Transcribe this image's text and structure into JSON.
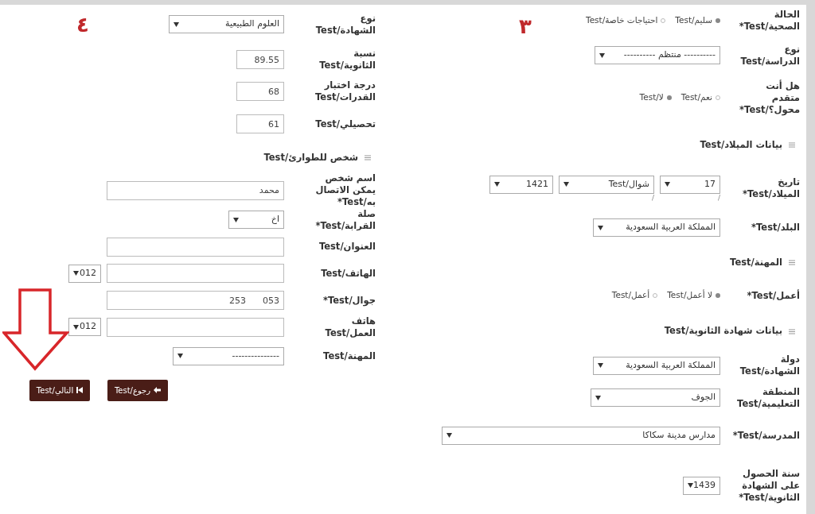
{
  "right_column": {
    "annotation": "٣",
    "rows": [
      {
        "kind": "radio",
        "label": "الحالة الصحية/Test*",
        "options": [
          {
            "label": "سليم/Test",
            "selected": true
          },
          {
            "label": "احتياجات خاصة/Test",
            "selected": false
          }
        ]
      },
      {
        "kind": "select",
        "label": "نوع الدراسة/Test",
        "value": "---------- منتظم ----------"
      },
      {
        "kind": "radio",
        "label": "هل أنت متقدم محول؟/Test*",
        "options": [
          {
            "label": "نعم/Test",
            "selected": false
          },
          {
            "label": "لا/Test",
            "selected": true
          }
        ]
      },
      {
        "kind": "section",
        "label": "بيانات الميلاد/Test"
      },
      {
        "kind": "date",
        "label": "تاريخ الميلاد/Test*",
        "parts": [
          {
            "value": "17",
            "separator": "/"
          },
          {
            "value": "شوال/Test",
            "separator": "/"
          },
          {
            "value": "1421"
          }
        ]
      },
      {
        "kind": "select",
        "label": "البلد/Test*",
        "value": "المملكة العربية السعودية"
      },
      {
        "kind": "section",
        "label": "المهنة/Test"
      },
      {
        "kind": "radio",
        "label": "أعمل/Test*",
        "options": [
          {
            "label": "لا أعمل/Test",
            "selected": true
          },
          {
            "label": "أعمل/Test",
            "selected": false
          }
        ]
      },
      {
        "kind": "section",
        "label": "بيانات شهادة الثانوية/Test"
      },
      {
        "kind": "select",
        "label": "دولة الشهادة/Test",
        "value": "المملكة العربية السعودية"
      },
      {
        "kind": "select",
        "label": "المنطقة التعليمية/Test",
        "value": "الجوف"
      },
      {
        "kind": "select",
        "label": "المدرسة/Test*",
        "value": "مدارس مدينة سكاكا"
      },
      {
        "kind": "select",
        "label": "سنة الحصول على الشهادة الثانوية/Test*",
        "value": "1439"
      }
    ]
  },
  "left_column": {
    "annotation": "٤",
    "rows": [
      {
        "kind": "select",
        "label": "نوع الشهادة/Test",
        "value": "العلوم الطبيعية"
      },
      {
        "kind": "input",
        "label": "نسبة الثانوية/Test",
        "value": "89.55"
      },
      {
        "kind": "input",
        "label": "درجة اختبار القدرات/Test",
        "value": "68"
      },
      {
        "kind": "input",
        "label": "تحصيلي/Test",
        "value": "61"
      },
      {
        "kind": "section",
        "label": "شخص للطوارئ/Test"
      },
      {
        "kind": "input",
        "label": "اسم شخص يمكن الاتصال به/Test*",
        "value": "محمد"
      },
      {
        "kind": "select",
        "label": "صلة القرابة/Test*",
        "value": "اخ"
      },
      {
        "kind": "input",
        "label": "العنوان/Test",
        "value": ""
      },
      {
        "kind": "phone",
        "label": "الهاتف/Test",
        "value": "",
        "code": "012"
      },
      {
        "kind": "input",
        "label": "جوال/Test*",
        "value": "053      253"
      },
      {
        "kind": "phone",
        "label": "هاتف العمل/Test",
        "value": "",
        "code": "012"
      },
      {
        "kind": "select",
        "label": "المهنة/Test",
        "value": "---------------"
      }
    ],
    "buttons": [
      {
        "kind": "back",
        "label": "رجوع/Test"
      },
      {
        "kind": "next",
        "label": "التالي/Test"
      }
    ]
  }
}
